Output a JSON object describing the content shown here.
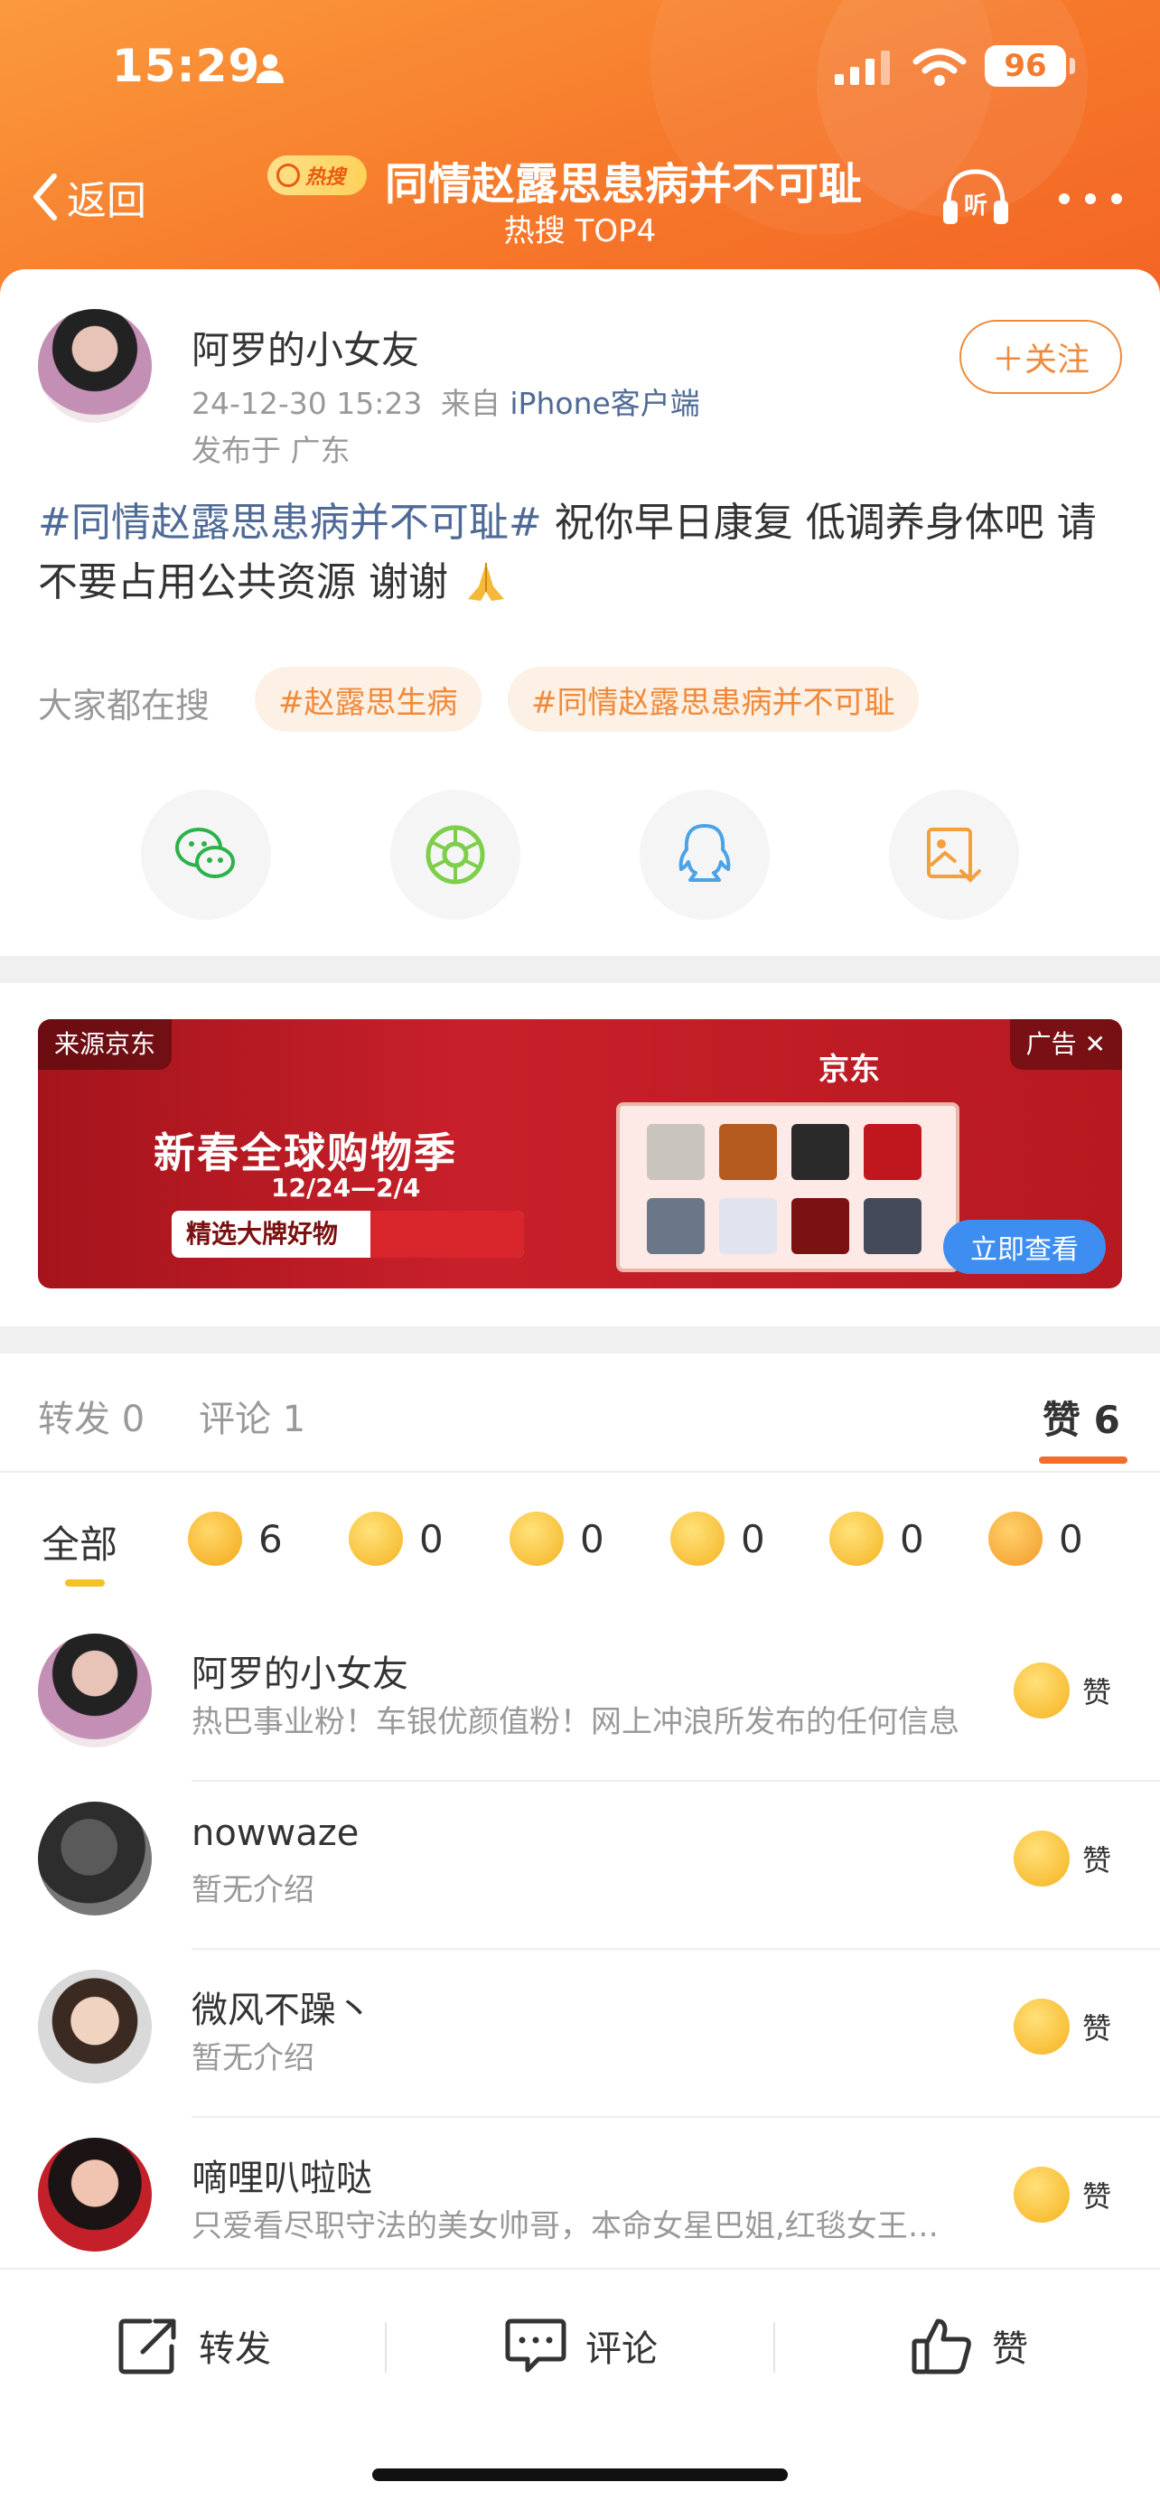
{
  "status_bar": {
    "time": "15:29",
    "battery": "96"
  },
  "header": {
    "back_label": "返回",
    "hot_badge": "热搜",
    "title": "同情赵露思患病并不可耻",
    "subtitle": "热搜 TOP4"
  },
  "post": {
    "author": "阿罗的小女友",
    "time": "24-12-30 15:23",
    "from_prefix": "来自",
    "source": "iPhone客户端",
    "location": "发布于 广东",
    "follow_label": "＋关注",
    "hashtag": "#同情赵露思患病并不可耻#",
    "body": " 祝你早日康复 低调养身体吧 请不要占用公共资源 谢谢",
    "everyone_searching_label": "大家都在搜",
    "search_chips": [
      "#赵露思生病",
      "#同情赵露思患病并不可耻"
    ]
  },
  "share_icons": [
    "wechat-icon",
    "moments-icon",
    "qq-icon",
    "save-image-icon"
  ],
  "ad": {
    "source_label": "来源京东",
    "ad_label": "广告 ✕",
    "brand": "京东",
    "headline": "新春全球购物季",
    "dates": "12/24—2/4",
    "pill_text": "精选大牌好物",
    "cta": "立即查看"
  },
  "tabs": {
    "repost": "转发 0",
    "comments": "评论 1",
    "likes": "赞 6"
  },
  "reactions": {
    "all_label": "全部",
    "items": [
      {
        "icon": "thumbs-up-icon",
        "count": "6"
      },
      {
        "icon": "laughing-icon",
        "count": "0"
      },
      {
        "icon": "surprised-icon",
        "count": "0"
      },
      {
        "icon": "sad-icon",
        "count": "0"
      },
      {
        "icon": "heart-icon",
        "count": "0"
      },
      {
        "icon": "blush-icon",
        "count": "0"
      }
    ]
  },
  "likers": [
    {
      "name": "阿罗的小女友",
      "desc": "热巴事业粉！车银优颜值粉！网上冲浪所发布的任何信息",
      "like_label": "赞"
    },
    {
      "name": "nowwaze",
      "desc": "暂无介绍",
      "like_label": "赞"
    },
    {
      "name": "微风不躁丶",
      "desc": "暂无介绍",
      "like_label": "赞"
    },
    {
      "name": "嘀哩叭啦哒",
      "desc": "只爱看尽职守法的美女帅哥，本命女星巴姐,红毯女王宇宙第一",
      "like_label": "赞"
    }
  ],
  "bottom_bar": {
    "repost": "转发",
    "comment": "评论",
    "like": "赞"
  },
  "colors": {
    "accent": "#f6782b",
    "link": "#4f6a96",
    "chip_text": "#f08a3a",
    "chip_bg": "#fdf0e4"
  }
}
